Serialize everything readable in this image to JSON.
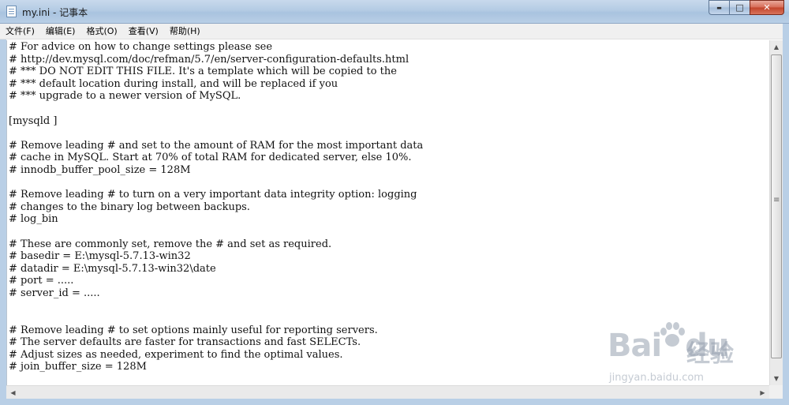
{
  "window": {
    "title": "my.ini - 记事本",
    "minimize_glyph": "▬",
    "maximize_glyph": "□",
    "close_glyph": "✕"
  },
  "menu": {
    "items": [
      {
        "label": "文件(F)"
      },
      {
        "label": "编辑(E)"
      },
      {
        "label": "格式(O)"
      },
      {
        "label": "查看(V)"
      },
      {
        "label": "帮助(H)"
      }
    ]
  },
  "editor": {
    "lines": [
      "# For advice on how to change settings please see",
      "# http://dev.mysql.com/doc/refman/5.7/en/server-configuration-defaults.html",
      "# *** DO NOT EDIT THIS FILE. It's a template which will be copied to the",
      "# *** default location during install, and will be replaced if you",
      "# *** upgrade to a newer version of MySQL.",
      "",
      "[mysqld ]",
      "",
      "# Remove leading # and set to the amount of RAM for the most important data",
      "# cache in MySQL. Start at 70% of total RAM for dedicated server, else 10%.",
      "# innodb_buffer_pool_size = 128M",
      "",
      "# Remove leading # to turn on a very important data integrity option: logging",
      "# changes to the binary log between backups.",
      "# log_bin",
      "",
      "# These are commonly set, remove the # and set as required.",
      "# basedir = E:\\mysql-5.7.13-win32",
      "# datadir = E:\\mysql-5.7.13-win32\\date",
      "# port = .....",
      "# server_id = .....",
      "",
      "",
      "# Remove leading # to set options mainly useful for reporting servers.",
      "# The server defaults are faster for transactions and fast SELECTs.",
      "# Adjust sizes as needed, experiment to find the optimal values.",
      "# join_buffer_size = 128M"
    ]
  },
  "scrollbars": {
    "up_glyph": "▲",
    "down_glyph": "▼",
    "left_glyph": "◀",
    "right_glyph": "▶"
  },
  "watermark": {
    "logo": "Bai",
    "logo_tail": "du",
    "experience": "经验",
    "url": "jingyan.baidu.com"
  }
}
